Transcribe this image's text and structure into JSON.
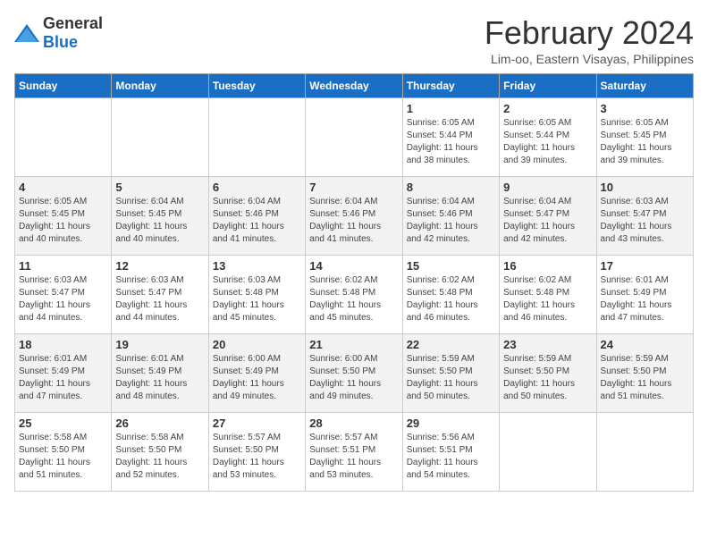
{
  "header": {
    "logo_general": "General",
    "logo_blue": "Blue",
    "title": "February 2024",
    "subtitle": "Lim-oo, Eastern Visayas, Philippines"
  },
  "weekdays": [
    "Sunday",
    "Monday",
    "Tuesday",
    "Wednesday",
    "Thursday",
    "Friday",
    "Saturday"
  ],
  "weeks": [
    [
      {
        "day": "",
        "info": ""
      },
      {
        "day": "",
        "info": ""
      },
      {
        "day": "",
        "info": ""
      },
      {
        "day": "",
        "info": ""
      },
      {
        "day": "1",
        "info": "Sunrise: 6:05 AM\nSunset: 5:44 PM\nDaylight: 11 hours\nand 38 minutes."
      },
      {
        "day": "2",
        "info": "Sunrise: 6:05 AM\nSunset: 5:44 PM\nDaylight: 11 hours\nand 39 minutes."
      },
      {
        "day": "3",
        "info": "Sunrise: 6:05 AM\nSunset: 5:45 PM\nDaylight: 11 hours\nand 39 minutes."
      }
    ],
    [
      {
        "day": "4",
        "info": "Sunrise: 6:05 AM\nSunset: 5:45 PM\nDaylight: 11 hours\nand 40 minutes."
      },
      {
        "day": "5",
        "info": "Sunrise: 6:04 AM\nSunset: 5:45 PM\nDaylight: 11 hours\nand 40 minutes."
      },
      {
        "day": "6",
        "info": "Sunrise: 6:04 AM\nSunset: 5:46 PM\nDaylight: 11 hours\nand 41 minutes."
      },
      {
        "day": "7",
        "info": "Sunrise: 6:04 AM\nSunset: 5:46 PM\nDaylight: 11 hours\nand 41 minutes."
      },
      {
        "day": "8",
        "info": "Sunrise: 6:04 AM\nSunset: 5:46 PM\nDaylight: 11 hours\nand 42 minutes."
      },
      {
        "day": "9",
        "info": "Sunrise: 6:04 AM\nSunset: 5:47 PM\nDaylight: 11 hours\nand 42 minutes."
      },
      {
        "day": "10",
        "info": "Sunrise: 6:03 AM\nSunset: 5:47 PM\nDaylight: 11 hours\nand 43 minutes."
      }
    ],
    [
      {
        "day": "11",
        "info": "Sunrise: 6:03 AM\nSunset: 5:47 PM\nDaylight: 11 hours\nand 44 minutes."
      },
      {
        "day": "12",
        "info": "Sunrise: 6:03 AM\nSunset: 5:47 PM\nDaylight: 11 hours\nand 44 minutes."
      },
      {
        "day": "13",
        "info": "Sunrise: 6:03 AM\nSunset: 5:48 PM\nDaylight: 11 hours\nand 45 minutes."
      },
      {
        "day": "14",
        "info": "Sunrise: 6:02 AM\nSunset: 5:48 PM\nDaylight: 11 hours\nand 45 minutes."
      },
      {
        "day": "15",
        "info": "Sunrise: 6:02 AM\nSunset: 5:48 PM\nDaylight: 11 hours\nand 46 minutes."
      },
      {
        "day": "16",
        "info": "Sunrise: 6:02 AM\nSunset: 5:48 PM\nDaylight: 11 hours\nand 46 minutes."
      },
      {
        "day": "17",
        "info": "Sunrise: 6:01 AM\nSunset: 5:49 PM\nDaylight: 11 hours\nand 47 minutes."
      }
    ],
    [
      {
        "day": "18",
        "info": "Sunrise: 6:01 AM\nSunset: 5:49 PM\nDaylight: 11 hours\nand 47 minutes."
      },
      {
        "day": "19",
        "info": "Sunrise: 6:01 AM\nSunset: 5:49 PM\nDaylight: 11 hours\nand 48 minutes."
      },
      {
        "day": "20",
        "info": "Sunrise: 6:00 AM\nSunset: 5:49 PM\nDaylight: 11 hours\nand 49 minutes."
      },
      {
        "day": "21",
        "info": "Sunrise: 6:00 AM\nSunset: 5:50 PM\nDaylight: 11 hours\nand 49 minutes."
      },
      {
        "day": "22",
        "info": "Sunrise: 5:59 AM\nSunset: 5:50 PM\nDaylight: 11 hours\nand 50 minutes."
      },
      {
        "day": "23",
        "info": "Sunrise: 5:59 AM\nSunset: 5:50 PM\nDaylight: 11 hours\nand 50 minutes."
      },
      {
        "day": "24",
        "info": "Sunrise: 5:59 AM\nSunset: 5:50 PM\nDaylight: 11 hours\nand 51 minutes."
      }
    ],
    [
      {
        "day": "25",
        "info": "Sunrise: 5:58 AM\nSunset: 5:50 PM\nDaylight: 11 hours\nand 51 minutes."
      },
      {
        "day": "26",
        "info": "Sunrise: 5:58 AM\nSunset: 5:50 PM\nDaylight: 11 hours\nand 52 minutes."
      },
      {
        "day": "27",
        "info": "Sunrise: 5:57 AM\nSunset: 5:50 PM\nDaylight: 11 hours\nand 53 minutes."
      },
      {
        "day": "28",
        "info": "Sunrise: 5:57 AM\nSunset: 5:51 PM\nDaylight: 11 hours\nand 53 minutes."
      },
      {
        "day": "29",
        "info": "Sunrise: 5:56 AM\nSunset: 5:51 PM\nDaylight: 11 hours\nand 54 minutes."
      },
      {
        "day": "",
        "info": ""
      },
      {
        "day": "",
        "info": ""
      }
    ]
  ]
}
